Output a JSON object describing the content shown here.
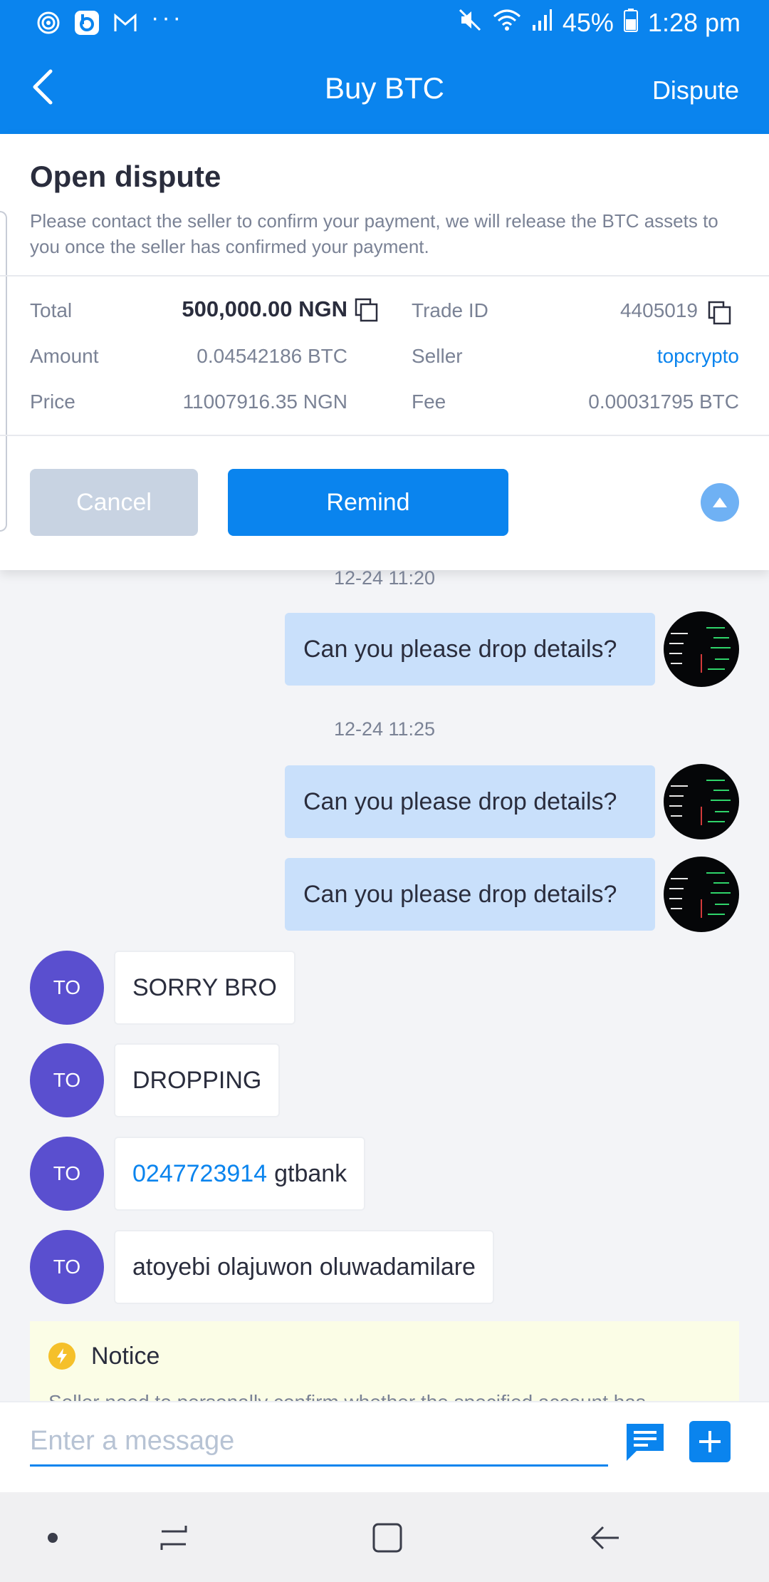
{
  "status_bar": {
    "icons_left": [
      "whirlpool-app-icon",
      "b-app-icon",
      "gmail-icon"
    ],
    "more": "···",
    "battery": "45%",
    "time": "1:28 pm",
    "icons_right": [
      "mute-icon",
      "wifi-icon",
      "signal-icon",
      "battery-icon"
    ]
  },
  "app_bar": {
    "title": "Buy BTC",
    "action": "Dispute",
    "color": "#0a84ee"
  },
  "dispute_panel": {
    "title": "Open dispute",
    "description": "Please contact the seller to confirm your payment, we will release the BTC assets to you once the seller has confirmed your payment.",
    "details": {
      "total_label": "Total",
      "total_value": "500,000.00 NGN",
      "amount_label": "Amount",
      "amount_value": "0.04542186 BTC",
      "price_label": "Price",
      "price_value": "11007916.35 NGN",
      "trade_id_label": "Trade ID",
      "trade_id_value": "4405019",
      "seller_label": "Seller",
      "seller_value": "topcrypto",
      "fee_label": "Fee",
      "fee_value": "0.00031795 BTC"
    },
    "cancel_label": "Cancel",
    "remind_label": "Remind"
  },
  "chat": {
    "timestamps": [
      "12-24 11:20",
      "12-24 11:25"
    ],
    "outgoing": [
      "Can you please drop details?",
      "Can you please drop details?",
      "Can you please drop details?"
    ],
    "incoming_avatar": "TO",
    "incoming": [
      {
        "text": "SORRY BRO"
      },
      {
        "text": "DROPPING"
      },
      {
        "account": "0247723914",
        "text": "gtbank"
      },
      {
        "text": "atoyebi olajuwon oluwadamilare"
      }
    ]
  },
  "notice": {
    "title": "Notice",
    "text": "Seller need to personally confirm whether the specified account has"
  },
  "composer": {
    "placeholder": "Enter a message",
    "value": ""
  }
}
